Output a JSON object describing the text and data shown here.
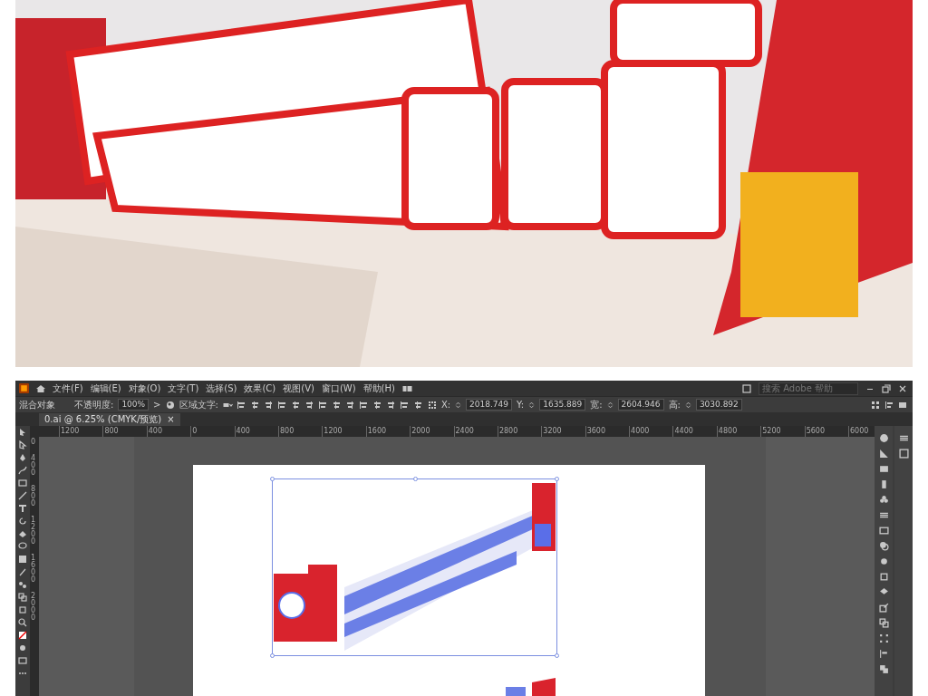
{
  "menu_bar": {
    "items": [
      "文件(F)",
      "编辑(E)",
      "对象(O)",
      "文字(T)",
      "选择(S)",
      "效果(C)",
      "视图(V)",
      "窗口(W)",
      "帮助(H)"
    ],
    "search": {
      "placeholder": "搜索 Adobe 帮助"
    }
  },
  "control_bar": {
    "object_type": "混合对象",
    "opacity_label": "不透明度:",
    "opacity_value": "100%",
    "more": ">",
    "area_text_label": "区域文字:",
    "fields": [
      {
        "label": "X:",
        "value": "2018.749"
      },
      {
        "label": "Y:",
        "value": "1635.889"
      },
      {
        "label": "宽:",
        "value": "2604.946"
      },
      {
        "label": "高:",
        "value": "3030.892"
      }
    ]
  },
  "document_tab": {
    "title": "0.ai @ 6.25% (CMYK/预览)",
    "close": "×"
  },
  "ruler": {
    "horizontal": [
      "1200",
      "800",
      "400",
      "0",
      "400",
      "800",
      "1200",
      "1600",
      "2000",
      "2400",
      "2800",
      "3200",
      "3600",
      "4000",
      "4400",
      "4800",
      "5200",
      "5600",
      "6000"
    ],
    "vertical": [
      "0",
      "400",
      "800",
      "1200",
      "1600",
      "2000"
    ]
  }
}
